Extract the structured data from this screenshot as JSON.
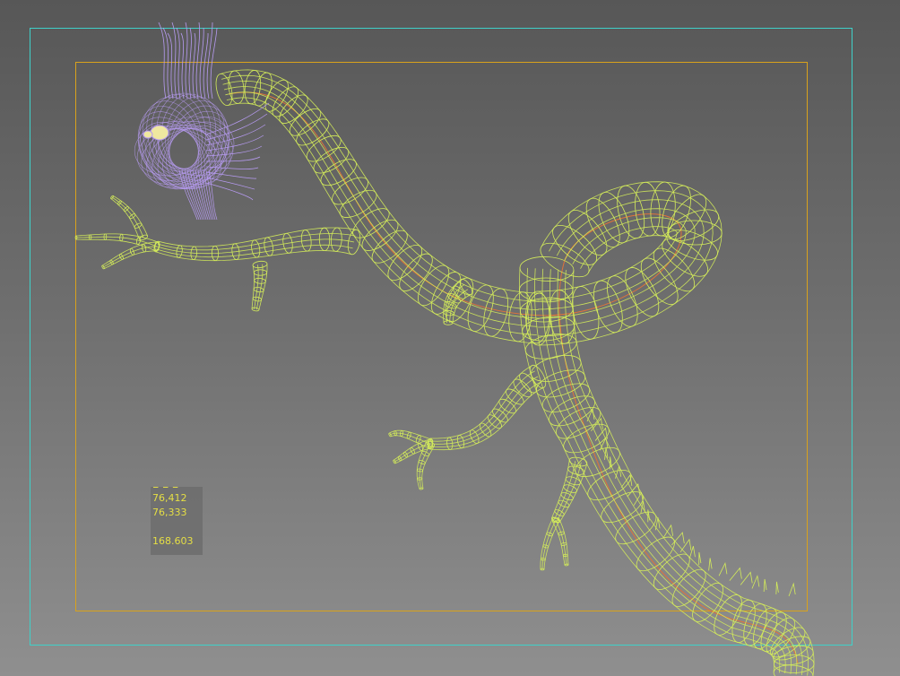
{
  "viewport": {
    "colors": {
      "safe_frame": "#3fd1c9",
      "render_frame": "#d9a21c",
      "wire_body": "#d4ec5a",
      "wire_head": "#b79bf2",
      "spline": "#e0733a",
      "stats_text": "#e6df44"
    },
    "model": {
      "name": "dragon-wireframe",
      "head_icon": "dragon-head"
    }
  },
  "stats": {
    "truncated_label": "▪ ▪ ▪",
    "row_1": "76,412",
    "row_2": "76,333",
    "row_3": "168.603"
  }
}
